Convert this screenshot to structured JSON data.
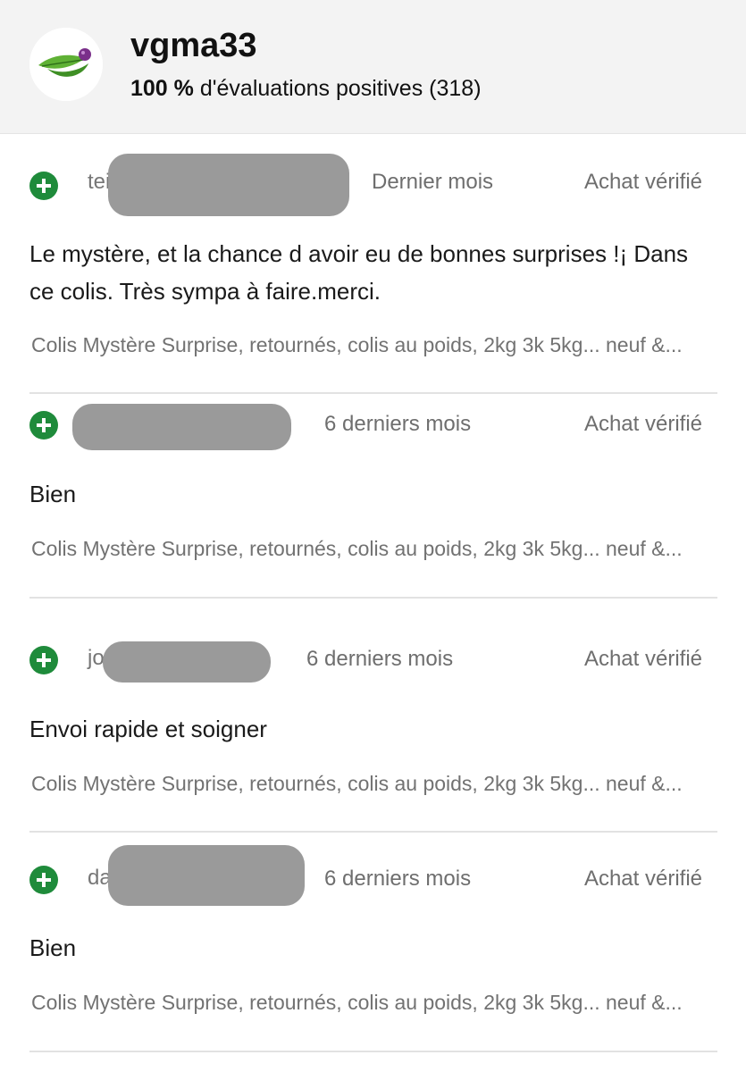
{
  "seller": {
    "name": "vgma33",
    "rating_percent": "100 %",
    "rating_text": "d'évaluations positives (318)",
    "avatar_icon": "leaf-logo-icon"
  },
  "colors": {
    "positive_green": "#1f8b3b",
    "header_bg": "#f3f3f3",
    "redaction_gray": "#9a9a9a"
  },
  "reviews": [
    {
      "user_prefix": "tei",
      "period": "Dernier mois",
      "verified": "Achat vérifié",
      "comment": "Le mystère, et la chance d avoir eu de bonnes surprises !¡ Dans ce colis. Très sympa à faire.merci.",
      "item": "Colis Mystère Surprise, retournés, colis au poids, 2kg 3k 5kg... neuf &..."
    },
    {
      "user_prefix": "",
      "period": "6 derniers mois",
      "verified": "Achat vérifié",
      "comment": "Bien",
      "item": "Colis Mystère Surprise, retournés, colis au poids, 2kg 3k 5kg... neuf &..."
    },
    {
      "user_prefix": "jo",
      "period": "6 derniers mois",
      "verified": "Achat vérifié",
      "comment": "Envoi rapide et soigner",
      "item": "Colis Mystère Surprise, retournés, colis au poids, 2kg 3k 5kg... neuf &..."
    },
    {
      "user_prefix": "da",
      "period": "6 derniers mois",
      "verified": "Achat vérifié",
      "comment": "Bien",
      "item": "Colis Mystère Surprise, retournés, colis au poids, 2kg 3k 5kg... neuf &..."
    }
  ]
}
